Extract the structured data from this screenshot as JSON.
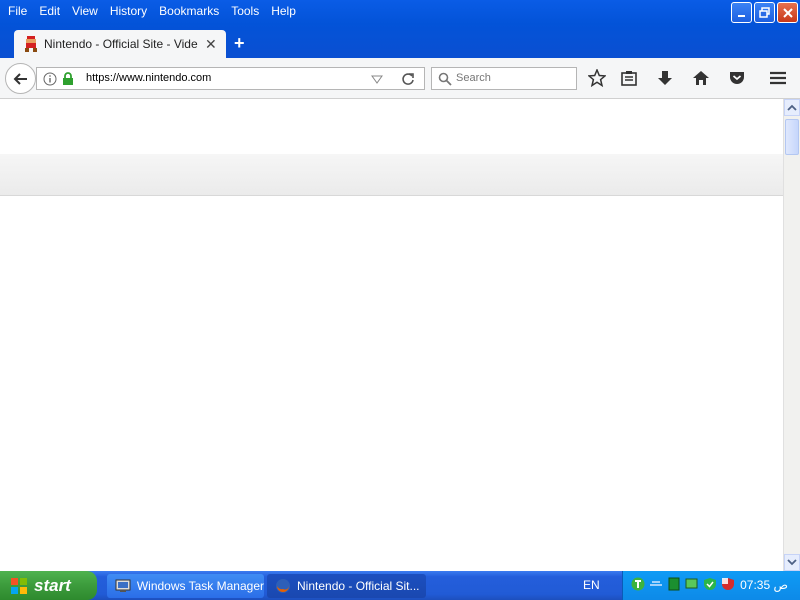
{
  "menubar": {
    "items": [
      {
        "label": "File"
      },
      {
        "label": "Edit"
      },
      {
        "label": "View"
      },
      {
        "label": "History"
      },
      {
        "label": "Bookmarks"
      },
      {
        "label": "Tools"
      },
      {
        "label": "Help"
      }
    ]
  },
  "tabs": [
    {
      "title": "Nintendo - Official Site - Video G",
      "active": true
    }
  ],
  "navbar": {
    "url": "https://www.nintendo.com",
    "search_placeholder": "Search"
  },
  "taskbar": {
    "start_label": "start",
    "tasks": [
      {
        "label": "Windows Task Manager"
      },
      {
        "label": "Nintendo - Official Sit..."
      }
    ],
    "language": "EN",
    "clock": "07:35 ص"
  },
  "colors": {
    "titlebar": "#0353d8",
    "taskbar": "#245edb",
    "start": "#3c9b3c",
    "close": "#c8381a"
  }
}
